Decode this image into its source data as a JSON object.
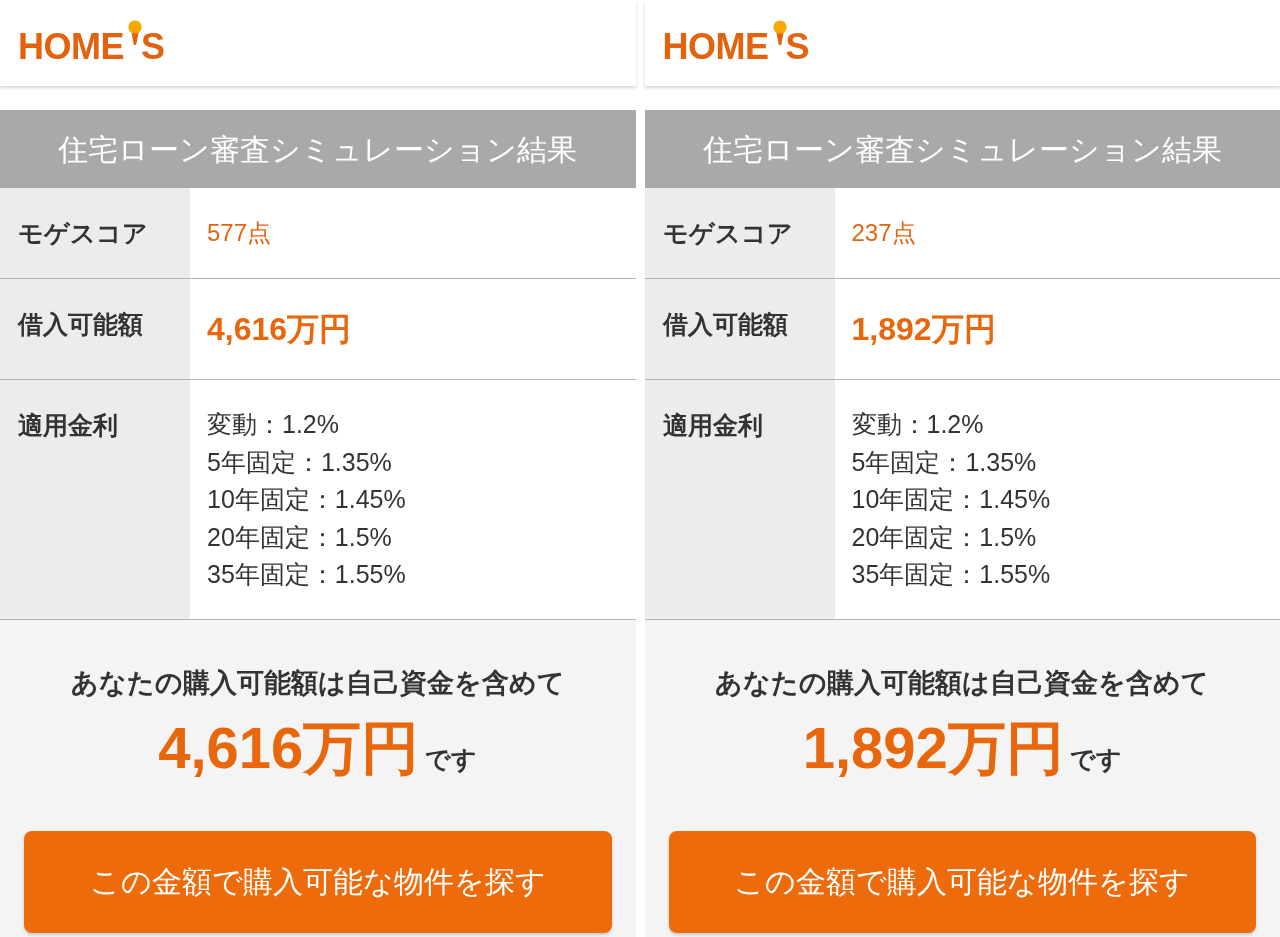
{
  "panels": [
    {
      "logo": {
        "parts": [
          "HOME",
          "S"
        ]
      },
      "title": "住宅ローン審査シミュレーション結果",
      "rows": [
        {
          "kind": "score",
          "label": "モゲスコア",
          "value": "577点"
        },
        {
          "kind": "amount",
          "label": "借入可能額",
          "value": "4,616万円"
        },
        {
          "kind": "rates",
          "label": "適用金利",
          "lines": [
            "変動：1.2%",
            "5年固定：1.35%",
            "10年固定：1.45%",
            "20年固定：1.5%",
            "35年固定：1.55%"
          ]
        }
      ],
      "summary": {
        "lead": "あなたの購入可能額は自己資金を含めて",
        "amount": "4,616万円",
        "suffix": "です"
      },
      "button": "この金額で購入可能な物件を探す"
    },
    {
      "logo": {
        "parts": [
          "HOME",
          "S"
        ]
      },
      "title": "住宅ローン審査シミュレーション結果",
      "rows": [
        {
          "kind": "score",
          "label": "モゲスコア",
          "value": "237点"
        },
        {
          "kind": "amount",
          "label": "借入可能額",
          "value": "1,892万円"
        },
        {
          "kind": "rates",
          "label": "適用金利",
          "lines": [
            "変動：1.2%",
            "5年固定：1.35%",
            "10年固定：1.45%",
            "20年固定：1.5%",
            "35年固定：1.55%"
          ]
        }
      ],
      "summary": {
        "lead": "あなたの購入可能額は自己資金を含めて",
        "amount": "1,892万円",
        "suffix": "です"
      },
      "button": "この金額で購入可能な物件を探す"
    }
  ]
}
